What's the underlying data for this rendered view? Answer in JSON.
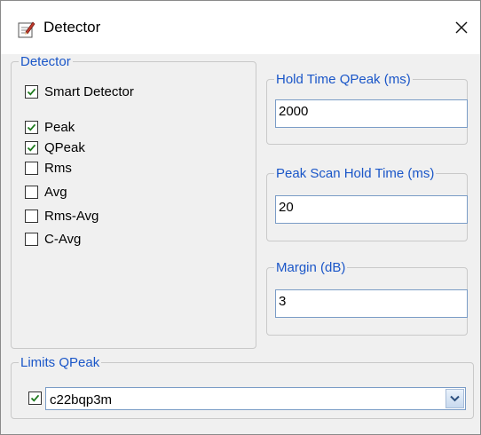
{
  "window": {
    "title": "Detector"
  },
  "detector_group": {
    "legend": "Detector",
    "options": [
      {
        "label": "Smart Detector",
        "checked": true
      },
      {
        "label": "Peak",
        "checked": true
      },
      {
        "label": "QPeak",
        "checked": true
      },
      {
        "label": "Rms",
        "checked": false
      },
      {
        "label": "Avg",
        "checked": false
      },
      {
        "label": "Rms-Avg",
        "checked": false
      },
      {
        "label": "C-Avg",
        "checked": false
      }
    ]
  },
  "hold_time_qpeak": {
    "legend": "Hold Time QPeak (ms)",
    "value": "2000"
  },
  "peak_scan_hold_time": {
    "legend": "Peak Scan Hold Time (ms)",
    "value": "20"
  },
  "margin": {
    "legend": "Margin (dB)",
    "value": "3"
  },
  "limits_qpeak": {
    "legend": "Limits QPeak",
    "enabled": true,
    "selected": "c22bqp3m"
  },
  "colors": {
    "accent": "#1a56c8",
    "check": "#1e7a1e"
  }
}
